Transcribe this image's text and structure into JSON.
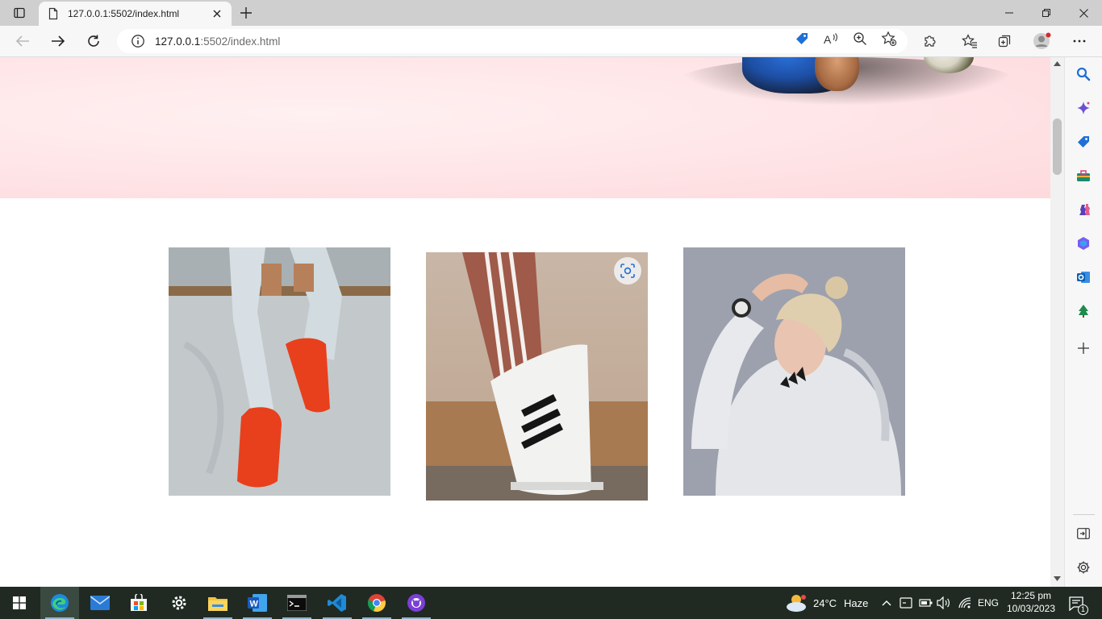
{
  "browser": {
    "tab_title": "127.0.0.1:5502/index.html",
    "address": {
      "host": "127.0.0.1",
      "rest": ":5502/index.html"
    }
  },
  "page": {
    "hero_background": "#ffe7e9",
    "gallery": [
      {
        "name": "orange-sneakers-photo",
        "alt": "Person wearing orange sneakers sitting on concrete"
      },
      {
        "name": "striped-sneaker-photo",
        "alt": "White sneaker with black stripes"
      },
      {
        "name": "hoodie-woman-photo",
        "alt": "Woman in white hoodie wearing a watch"
      }
    ]
  },
  "taskbar": {
    "weather": {
      "temp": "24°C",
      "condition": "Haze"
    },
    "language": "ENG",
    "time": "12:25 pm",
    "date": "10/03/2023",
    "notification_count": "1"
  },
  "colors": {
    "accent": "#0078d4",
    "taskbar": "#202a22"
  }
}
